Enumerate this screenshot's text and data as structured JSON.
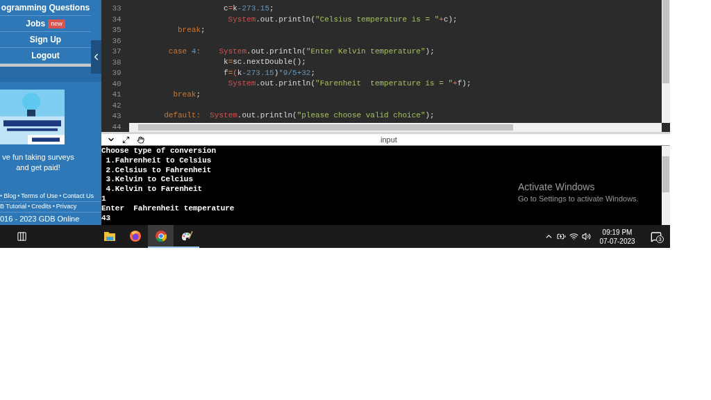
{
  "sidebar": {
    "menu": [
      {
        "label": "ogramming Questions"
      },
      {
        "label": "Jobs",
        "badge": "new"
      },
      {
        "label": "Sign Up"
      },
      {
        "label": "Logout"
      }
    ],
    "promo": [
      "ve fun taking surveys",
      "and get paid!"
    ],
    "footer_rows": [
      [
        {
          "kind": "separator",
          "text": "•"
        },
        {
          "kind": "link",
          "text": "Blog"
        },
        {
          "kind": "separator",
          "text": "•"
        },
        {
          "kind": "link",
          "text": "Terms of Use"
        },
        {
          "kind": "separator",
          "text": "•"
        },
        {
          "kind": "link",
          "text": "Contact Us"
        }
      ],
      [
        {
          "kind": "link",
          "text": "B Tutorial"
        },
        {
          "kind": "separator",
          "text": "•"
        },
        {
          "kind": "link",
          "text": "Credits"
        },
        {
          "kind": "separator",
          "text": "•"
        },
        {
          "kind": "link",
          "text": "Privacy"
        }
      ]
    ],
    "copyright": "016 - 2023 GDB Online"
  },
  "editor": {
    "lines": [
      {
        "number": "33",
        "tokens": [
          {
            "kind": "plain",
            "text": "                    c"
          },
          {
            "kind": "op",
            "text": "="
          },
          {
            "kind": "plain",
            "text": "k"
          },
          {
            "kind": "number",
            "text": "-273.15"
          },
          {
            "kind": "plain",
            "text": ";"
          }
        ]
      },
      {
        "number": "34",
        "tokens": [
          {
            "kind": "class",
            "text": "                     System"
          },
          {
            "kind": "plain",
            "text": ".out.println("
          },
          {
            "kind": "string",
            "text": "\"Celsius temperature is = \""
          },
          {
            "kind": "op",
            "text": "+"
          },
          {
            "kind": "plain",
            "text": "c);"
          }
        ]
      },
      {
        "number": "35",
        "tokens": [
          {
            "kind": "keyword",
            "text": "          break"
          },
          {
            "kind": "plain",
            "text": ";"
          }
        ]
      },
      {
        "number": "36"
      },
      {
        "number": "37",
        "tokens": [
          {
            "kind": "keyword",
            "text": "        case "
          },
          {
            "kind": "number",
            "text": "4"
          },
          {
            "kind": "keyword",
            "text": ":"
          },
          {
            "kind": "class",
            "text": "    System"
          },
          {
            "kind": "plain",
            "text": ".out.println("
          },
          {
            "kind": "string",
            "text": "\"Enter Kelvin temperature\""
          },
          {
            "kind": "plain",
            "text": ");"
          }
        ]
      },
      {
        "number": "38",
        "tokens": [
          {
            "kind": "plain",
            "text": "                    k"
          },
          {
            "kind": "op",
            "text": "="
          },
          {
            "kind": "plain",
            "text": "sc.nextDouble();"
          }
        ]
      },
      {
        "number": "39",
        "tokens": [
          {
            "kind": "plain",
            "text": "                    f"
          },
          {
            "kind": "op",
            "text": "=("
          },
          {
            "kind": "plain",
            "text": "k"
          },
          {
            "kind": "number",
            "text": "-273.15"
          },
          {
            "kind": "plain",
            "text": ")"
          },
          {
            "kind": "number",
            "text": "*9/5+32"
          },
          {
            "kind": "plain",
            "text": ";"
          }
        ]
      },
      {
        "number": "40",
        "tokens": [
          {
            "kind": "class",
            "text": "                     System"
          },
          {
            "kind": "plain",
            "text": ".out.println("
          },
          {
            "kind": "string",
            "text": "\"Farenheit  temperature is = \""
          },
          {
            "kind": "op",
            "text": "+"
          },
          {
            "kind": "plain",
            "text": "f);"
          }
        ]
      },
      {
        "number": "41",
        "tokens": [
          {
            "kind": "keyword",
            "text": "         break"
          },
          {
            "kind": "plain",
            "text": ";"
          }
        ]
      },
      {
        "number": "42"
      },
      {
        "number": "43",
        "tokens": [
          {
            "kind": "keyword",
            "text": "       default:"
          },
          {
            "kind": "class",
            "text": "  System"
          },
          {
            "kind": "plain",
            "text": ".out.println("
          },
          {
            "kind": "string",
            "text": "\"please choose valid choice\""
          },
          {
            "kind": "plain",
            "text": ");"
          }
        ]
      },
      {
        "number": "44"
      }
    ]
  },
  "console": {
    "title": "input",
    "lines": [
      "Choose type of conversion",
      " 1.Fahrenheit to Celsius",
      " 2.Celsius to Fahrenheit",
      " 3.Kelvin to Celcius",
      " 4.Kelvin to Farenheit",
      "1",
      "Enter  Fahrenheit temperature",
      "43"
    ]
  },
  "activation_notice": {
    "title": "Activate Windows",
    "subtitle": "Go to Settings to activate Windows."
  },
  "taskbar": {
    "apps": [
      {
        "kind": "files",
        "running": false,
        "selected": false
      },
      {
        "kind": "firefox",
        "running": false,
        "selected": false
      },
      {
        "kind": "chrome",
        "running": true,
        "selected": true
      },
      {
        "kind": "paint",
        "running": true,
        "selected": false
      }
    ],
    "time": "09:19 PM",
    "date": "07-07-2023",
    "notifications": "3"
  }
}
